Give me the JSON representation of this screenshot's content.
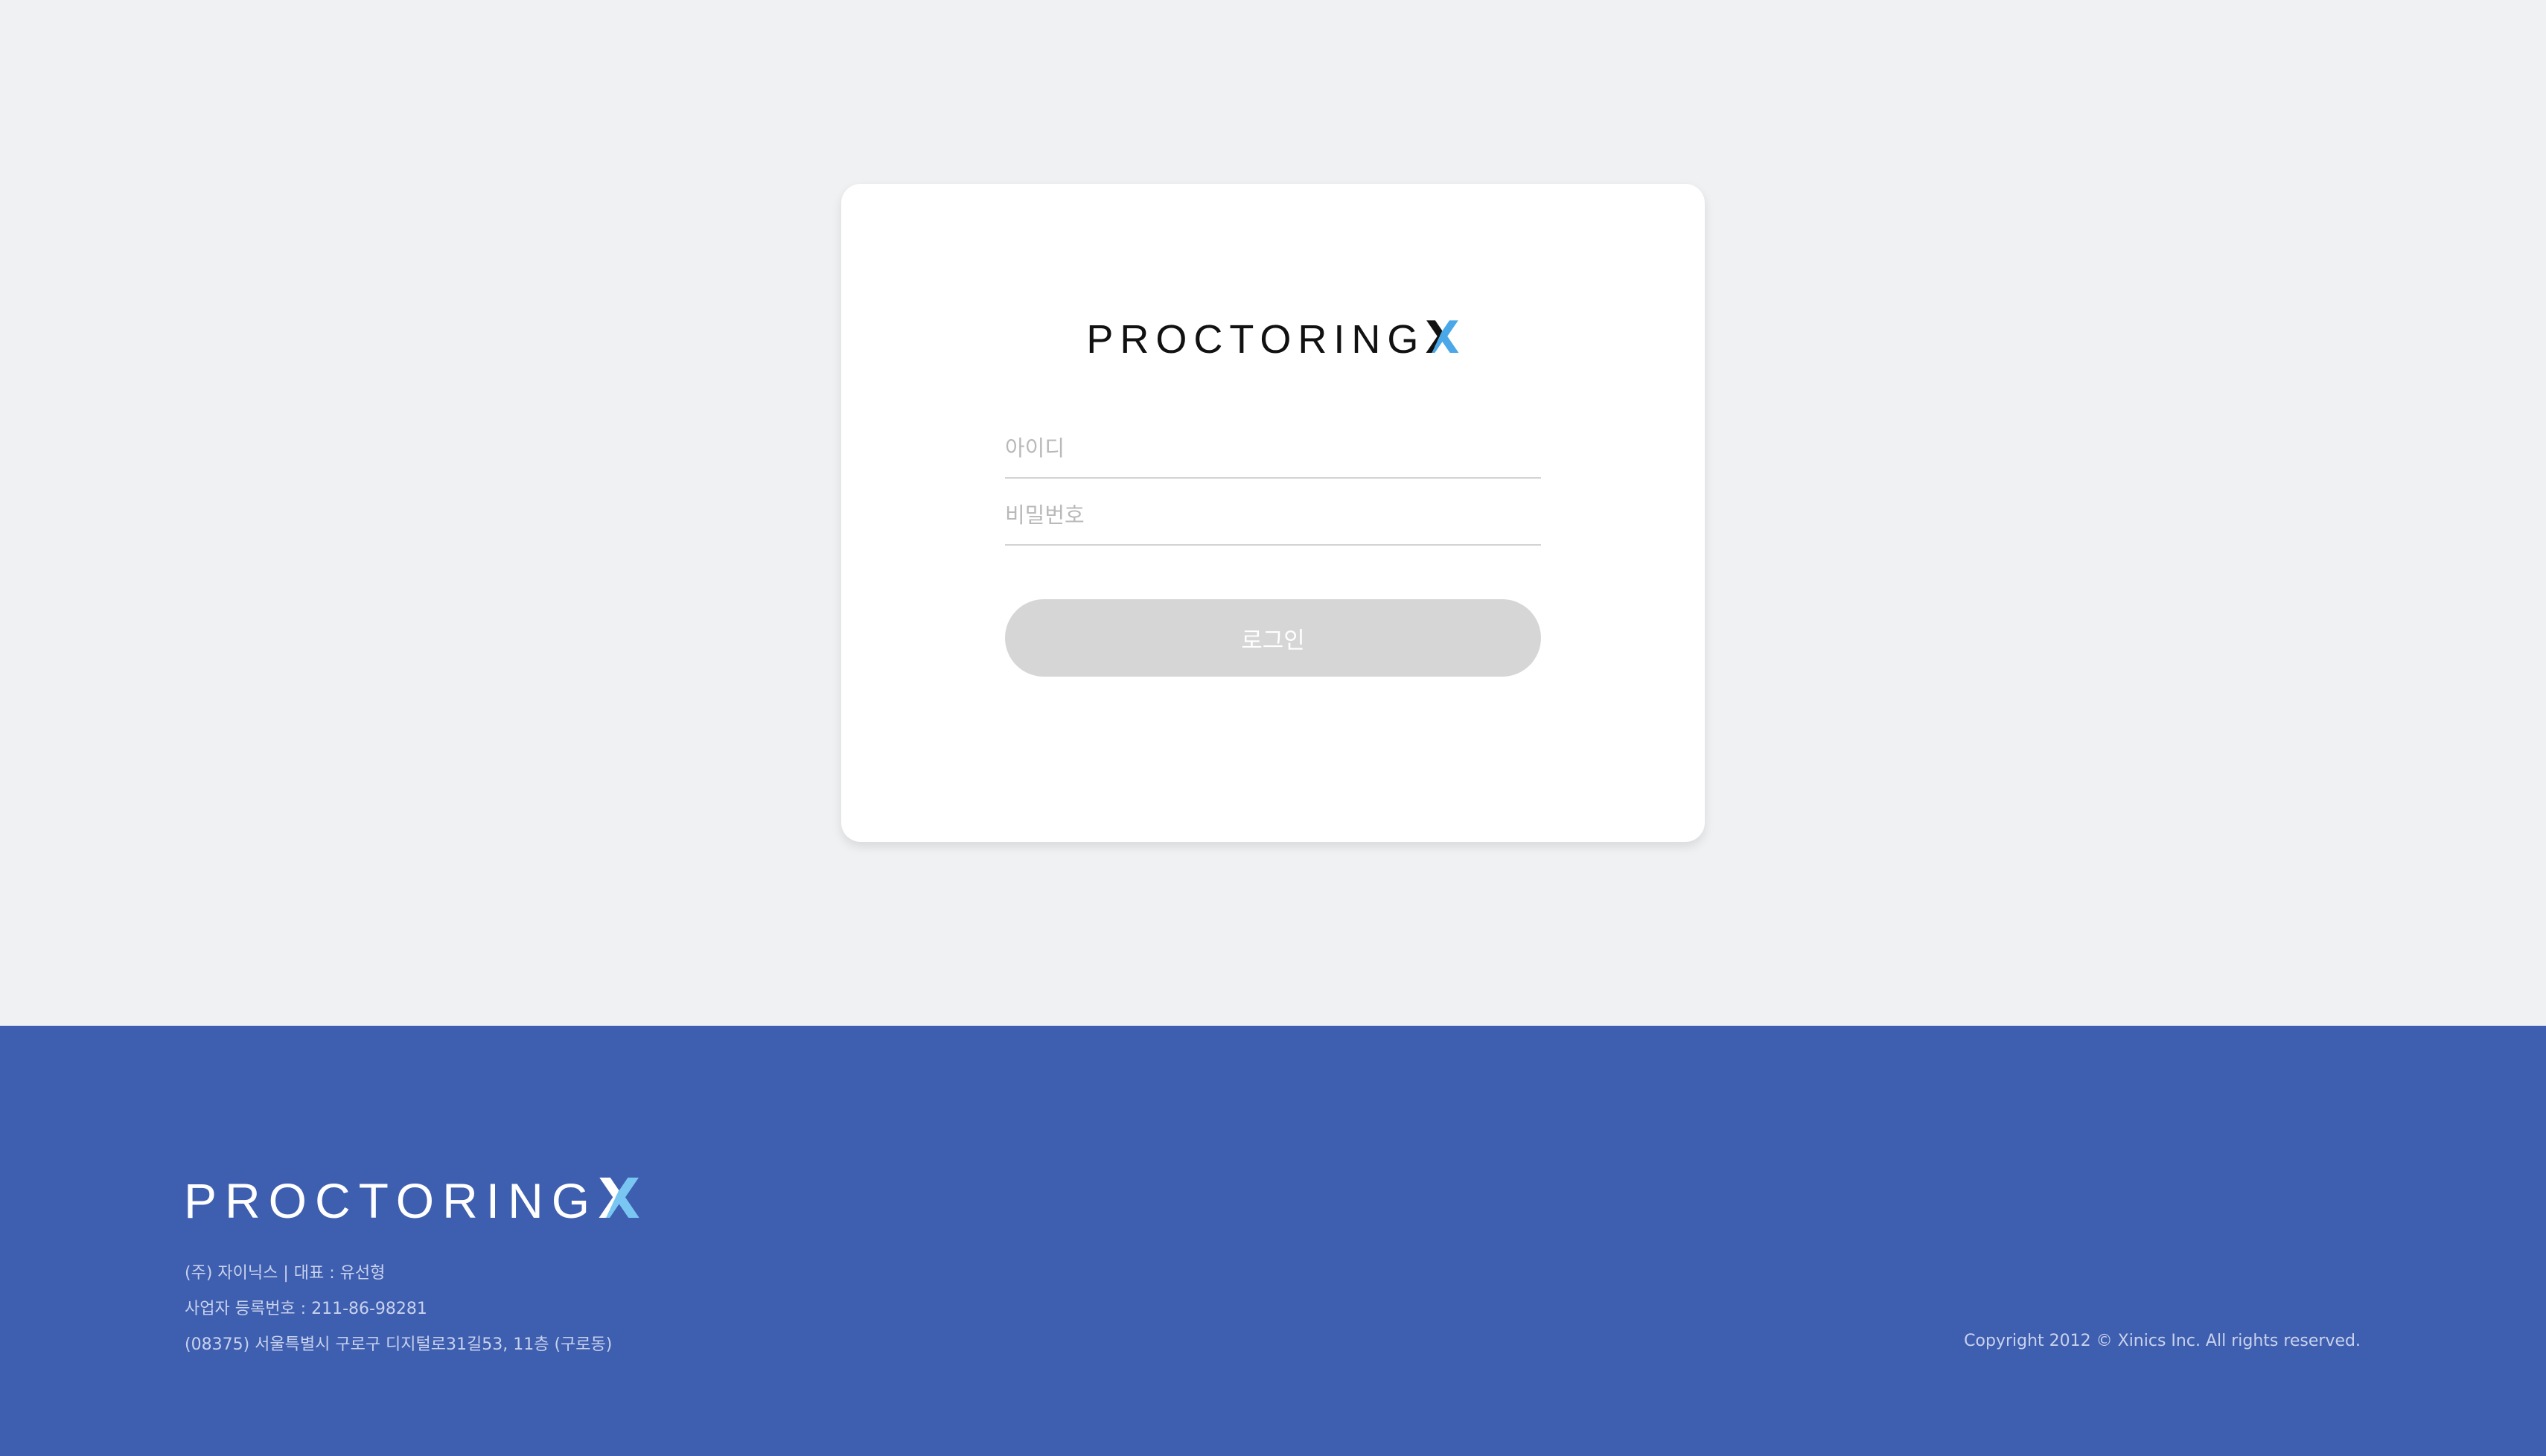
{
  "brand": {
    "name": "PROCTORING",
    "name_x": "X"
  },
  "login": {
    "id_placeholder": "아이디",
    "password_placeholder": "비밀번호",
    "button_label": "로그인"
  },
  "footer": {
    "company_line": "(주) 자이닉스 | 대표 : 유선형",
    "registration_line": "사업자 등록번호 : 211-86-98281",
    "address_line": "(08375) 서울특별시 구로구 디지털로31길53, 11층 (구로동)",
    "copyright": "Copyright 2012 © Xinics Inc. All rights reserved."
  },
  "colors": {
    "page_background": "#f0f1f3",
    "card_background": "#ffffff",
    "footer_background": "#3e5eb0",
    "button_disabled": "#d6d6d6",
    "logo_accent": "#4aa8e8"
  },
  "icons": {
    "card_logo": "proctoringx-logo",
    "footer_logo": "proctoringx-logo-white"
  }
}
